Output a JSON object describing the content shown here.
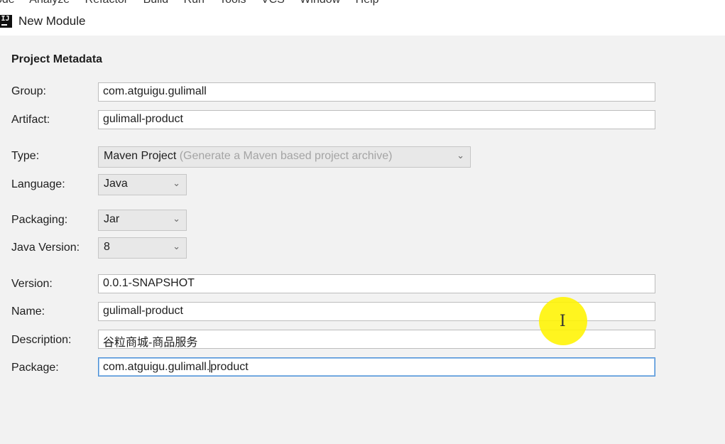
{
  "menu": {
    "items": [
      "ode",
      "Analyze",
      "Refactor",
      "Build",
      "Run",
      "Tools",
      "VCS",
      "Window",
      "Help"
    ]
  },
  "window": {
    "title": "New Module",
    "app_icon": "intellij-idea-icon",
    "app_icon_text": "IJ"
  },
  "form": {
    "section_title": "Project Metadata",
    "group": {
      "label": "Group:",
      "value": "com.atguigu.gulimall"
    },
    "artifact": {
      "label": "Artifact:",
      "value": "gulimall-product"
    },
    "type": {
      "label": "Type:",
      "value": "Maven Project",
      "hint": "(Generate a Maven based project archive)"
    },
    "language": {
      "label": "Language:",
      "value": "Java"
    },
    "packaging": {
      "label": "Packaging:",
      "value": "Jar"
    },
    "java_version": {
      "label": "Java Version:",
      "value": "8"
    },
    "version": {
      "label": "Version:",
      "value": "0.0.1-SNAPSHOT"
    },
    "name": {
      "label": "Name:",
      "value": "gulimall-product"
    },
    "description": {
      "label": "Description:",
      "value": "谷粒商城-商品服务"
    },
    "package": {
      "label": "Package:",
      "value_before_caret": "com.atguigu.gulimall.",
      "value_after_caret": "product"
    }
  },
  "colors": {
    "background": "#f2f2f2",
    "focus_border": "#4a8fd8",
    "cursor_highlight": "#fff400"
  }
}
